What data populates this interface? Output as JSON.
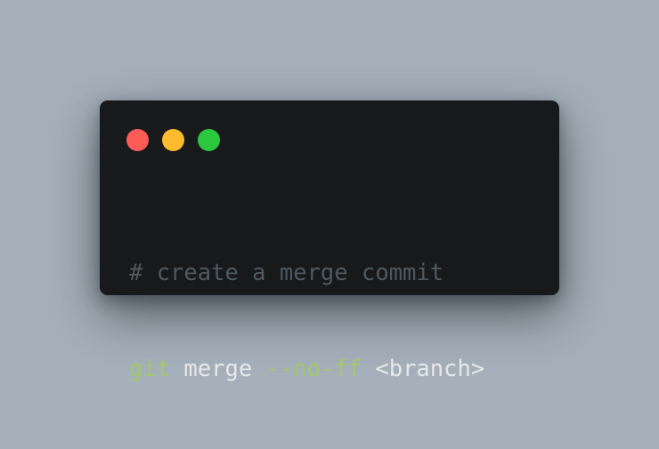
{
  "window": {
    "controls": [
      {
        "name": "close-dot",
        "color": "#fd5b56"
      },
      {
        "name": "minimize-dot",
        "color": "#fdbb2d"
      },
      {
        "name": "maximize-dot",
        "color": "#2bc840"
      }
    ],
    "code": {
      "comment": "# create a merge commit",
      "command": "git",
      "subcommand": "merge",
      "flag": "--no-ff",
      "argument": "<branch>"
    }
  },
  "colors": {
    "page_background": "#a5b0ba",
    "window_background": "#18191b",
    "comment": "#4e5960",
    "keyword": "#a3c66b",
    "text": "#e6e8ea"
  }
}
